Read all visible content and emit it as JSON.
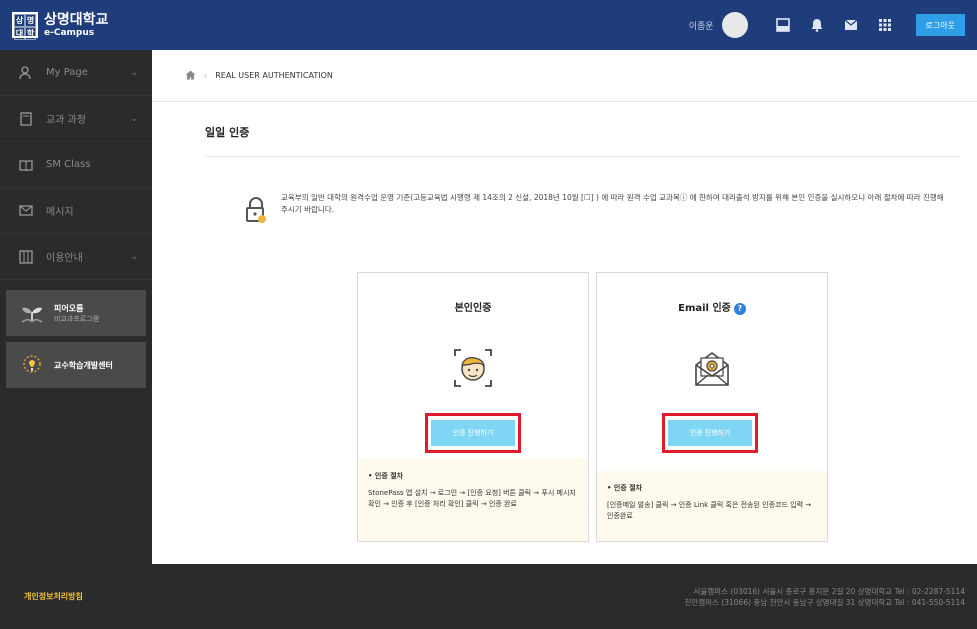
{
  "header": {
    "logo_badge": [
      "상",
      "명",
      "대",
      "학"
    ],
    "logo_title": "상명대학교",
    "logo_subtitle": "e-Campus",
    "user_name": "이종운",
    "login_label": "로그아웃"
  },
  "sidebar": {
    "items": [
      {
        "label": "My Page",
        "icon": "person-icon",
        "has_chevron": true
      },
      {
        "label": "교과 과정",
        "icon": "book-icon",
        "has_chevron": true
      },
      {
        "label": "SM Class",
        "icon": "open-book-icon",
        "has_chevron": false
      },
      {
        "label": "메시지",
        "icon": "mail-icon",
        "has_chevron": false
      },
      {
        "label": "이용안내",
        "icon": "guide-icon",
        "has_chevron": true
      }
    ],
    "banners": [
      {
        "title": "피어오름",
        "subtitle": "비교과프로그램"
      },
      {
        "title": "교수학습개발센터",
        "subtitle": ""
      }
    ]
  },
  "breadcrumb": {
    "current": "REAL USER AUTHENTICATION"
  },
  "main": {
    "title": "일일 인증",
    "notice": "교육부의 일반 대학의 원격수업 운영 기준(고등교육법 시행령 제 14조의 2 신설, 2018년 10월 [☐] ) 에 따라 원격 수업 교과목ⓘ 에 한하여 대리출석 방지를 위해 본인 인증을 실시하오니 아래 절차에 따라 진행해주시기 바랍니다."
  },
  "cards": [
    {
      "title": "본인인증",
      "button_label": "인증 진행하기",
      "procedure_title": "• 인증 절차",
      "procedure": "StonePass 앱 설치 → 로그인 → [인증 요청] 버튼 클릭 → 푸시 메시지 확인 → 인증 후 [인증 처리 확인] 클릭 → 인증 완료"
    },
    {
      "title": "Email 인증",
      "help": "?",
      "button_label": "인증 진행하기",
      "procedure_title": "• 인증 절차",
      "procedure": "[인증메일 발송] 클릭 → 인증 Link 클릭 혹은 전송된 인증코드 입력 → 인증완료"
    }
  ],
  "footer": {
    "privacy": "개인정보처리방침",
    "address1": "서울캠퍼스 (03016) 서울시 종로구 홍지문 2길 20 상명대학교   Tel : 02-2287-5114",
    "address2": "천안캠퍼스 (31066) 충남 천안시 동남구 상명대길 31 상명대학교   Tel : 041-550-5114"
  },
  "colors": {
    "header_bg": "#1f3d7a",
    "sidebar_bg": "#2b2b2b",
    "button_bg": "#7ed6f4",
    "highlight": "#e01b2e",
    "accent": "#2e9fe6"
  }
}
